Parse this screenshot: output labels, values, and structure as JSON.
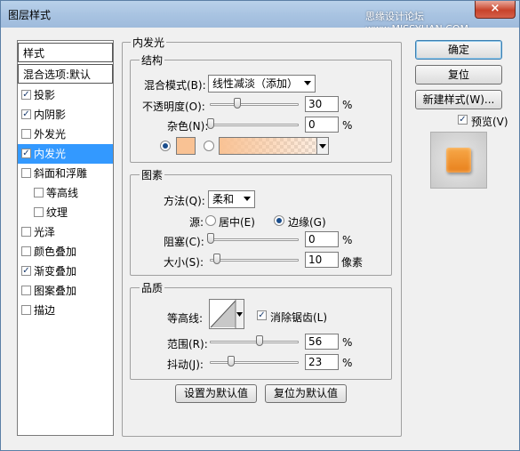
{
  "window": {
    "title": "图层样式",
    "watermark": "思缘设计论坛 www.MISSYUAN.COM",
    "close_symbol": "×"
  },
  "sidebar": {
    "header": "样式",
    "blend": "混合选项:默认",
    "items": [
      {
        "label": "投影",
        "checked": true
      },
      {
        "label": "内阴影",
        "checked": true
      },
      {
        "label": "外发光",
        "checked": false
      },
      {
        "label": "内发光",
        "checked": true,
        "selected": true
      },
      {
        "label": "斜面和浮雕",
        "checked": false
      },
      {
        "label": "等高线",
        "checked": false
      },
      {
        "label": "纹理",
        "checked": false
      },
      {
        "label": "光泽",
        "checked": false
      },
      {
        "label": "颜色叠加",
        "checked": false
      },
      {
        "label": "渐变叠加",
        "checked": true
      },
      {
        "label": "图案叠加",
        "checked": false
      },
      {
        "label": "描边",
        "checked": false
      }
    ]
  },
  "panel": {
    "title": "内发光",
    "structure": {
      "title": "结构",
      "blend_mode_label": "混合模式(B):",
      "blend_mode_value": "线性减淡（添加）",
      "opacity_label": "不透明度(O):",
      "opacity_value": "30",
      "noise_label": "杂色(N):",
      "noise_value": "0",
      "percent": "%",
      "opacity_level": 0.3,
      "noise_level": 0.0,
      "glow_color": "#f9c294"
    },
    "elements": {
      "title": "图素",
      "method_label": "方法(Q):",
      "method_value": "柔和",
      "source_label": "源:",
      "source_center": "居中(E)",
      "source_edge": "边缘(G)",
      "choke_label": "阻塞(C):",
      "choke_value": "0",
      "size_label": "大小(S):",
      "size_value": "10",
      "size_unit": "像素",
      "percent": "%",
      "choke_level": 0.0,
      "size_level": 0.04
    },
    "quality": {
      "title": "品质",
      "contour_label": "等高线:",
      "antialias_label": "消除锯齿(L)",
      "antialias_checked": true,
      "range_label": "范围(R):",
      "range_value": "56",
      "jitter_label": "抖动(J):",
      "jitter_value": "23",
      "percent": "%",
      "range_level": 0.56,
      "jitter_level": 0.23
    },
    "make_default": "设置为默认值",
    "reset_default": "复位为默认值"
  },
  "actions": {
    "ok": "确定",
    "reset": "复位",
    "new_style": "新建样式(W)...",
    "preview": "预览(V)",
    "preview_checked": true,
    "preview_color": "#f08c2a"
  }
}
